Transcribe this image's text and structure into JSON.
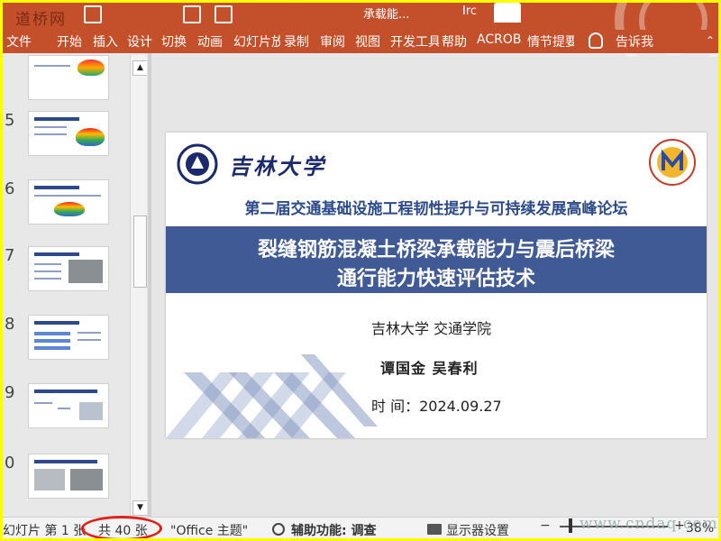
{
  "titlebar": {
    "watermark": "道桥网",
    "document_title": "承载能...",
    "user": "Irc"
  },
  "ribbon_tabs": [
    "文件",
    "开始",
    "插入",
    "设计",
    "切换",
    "动画",
    "幻灯片放",
    "录制",
    "审阅",
    "视图",
    "开发工具",
    "帮助",
    "ACROBAT",
    "情节提要",
    "告诉我"
  ],
  "thumbnails": [
    {
      "number": ""
    },
    {
      "number": "5"
    },
    {
      "number": "6"
    },
    {
      "number": "7"
    },
    {
      "number": "8"
    },
    {
      "number": "9"
    },
    {
      "number": "0"
    }
  ],
  "slide": {
    "university_name": "吉林大学",
    "forum_title": "第二届交通基础设施工程韧性提升与可持续发展高峰论坛",
    "title_line1": "裂缝钢筋混凝土桥梁承载能力与震后桥梁",
    "title_line2": "通行能力快速评估技术",
    "affiliation": "吉林大学  交通学院",
    "authors": "谭国金  吴春利",
    "date": "时  间：2024.09.27"
  },
  "statusbar": {
    "slide_indicator": "幻灯片 第 1 张",
    "total": "共 40 张",
    "theme": "\"Office 主题\"",
    "accessibility": "辅助功能: 调查",
    "display_settings": "显示器设置",
    "zoom": "38%"
  },
  "site_watermark": "www.cndaq.com",
  "colors": {
    "ribbon": "#c4502b",
    "title_band": "#3f5a95",
    "accent_blue": "#2c4a8a",
    "annotation": "#e0201a",
    "frame": "#ffff00"
  }
}
